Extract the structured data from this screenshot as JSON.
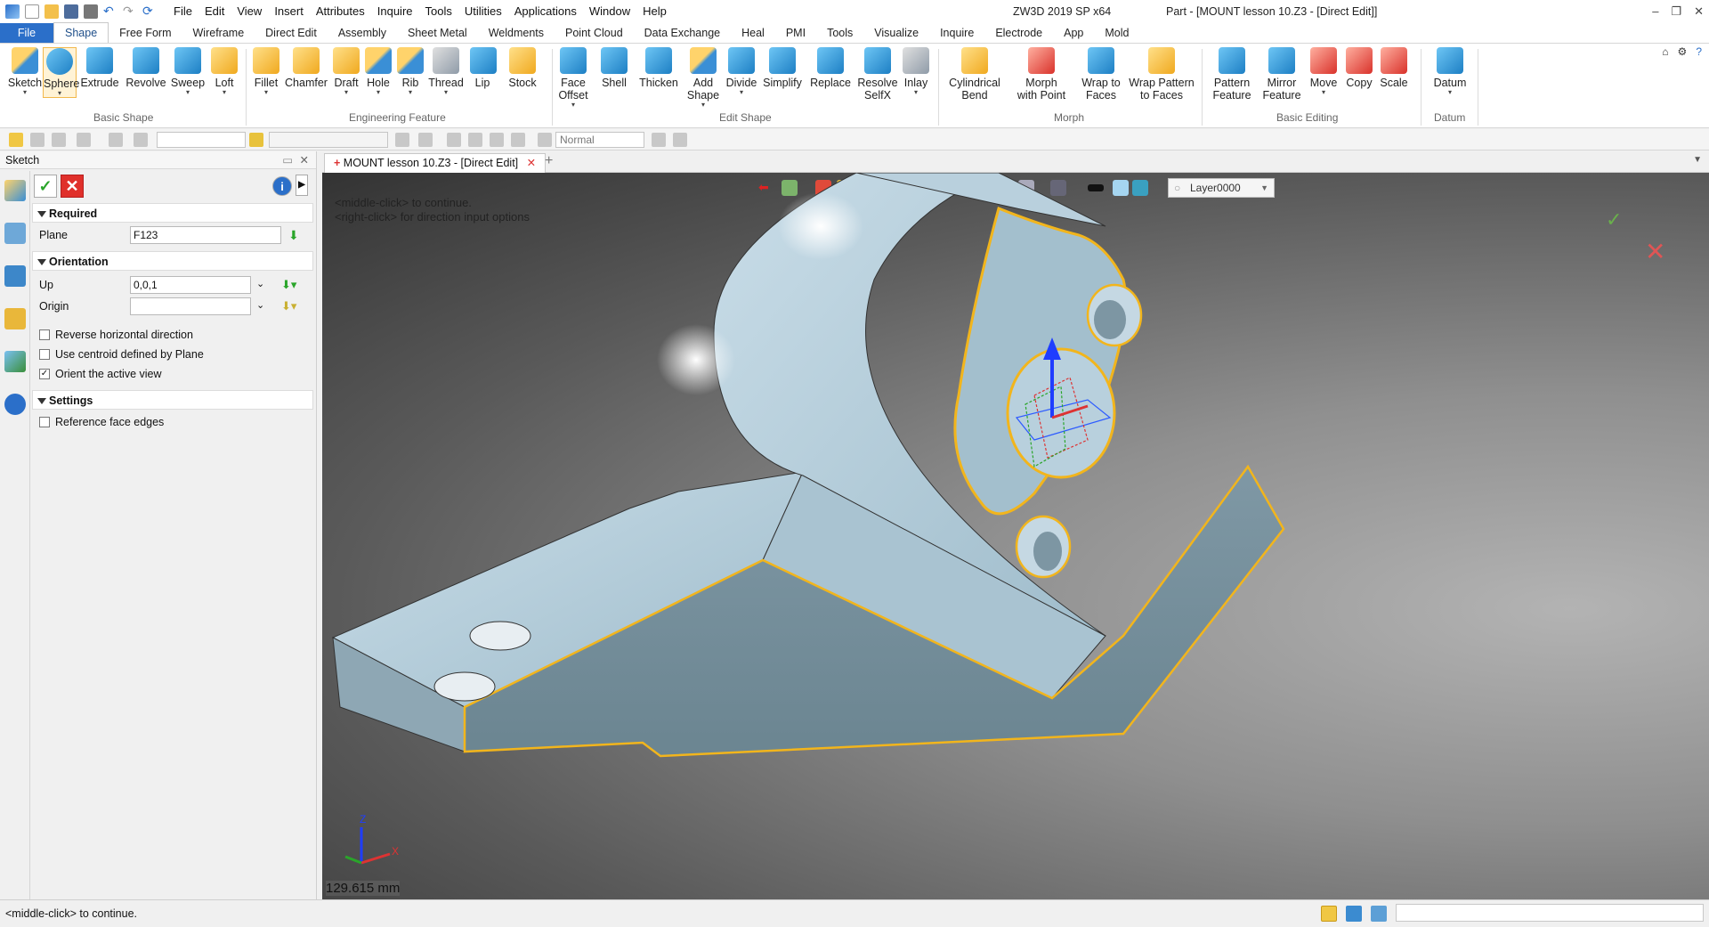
{
  "app": {
    "title": "ZW3D 2019 SP x64",
    "document_title": "Part - [MOUNT lesson 10.Z3 - [Direct Edit]]",
    "menu": [
      "File",
      "Edit",
      "View",
      "Insert",
      "Attributes",
      "Inquire",
      "Tools",
      "Utilities",
      "Applications",
      "Window",
      "Help"
    ]
  },
  "ribbon_tabs": [
    "File",
    "Shape",
    "Free Form",
    "Wireframe",
    "Direct Edit",
    "Assembly",
    "Sheet Metal",
    "Weldments",
    "Point Cloud",
    "Data Exchange",
    "Heal",
    "PMI",
    "Tools",
    "Visualize",
    "Inquire",
    "Electrode",
    "App",
    "Mold"
  ],
  "ribbon_groups": {
    "basic_shape": {
      "label": "Basic Shape",
      "buttons": [
        "Sketch",
        "Sphere",
        "Extrude",
        "Revolve",
        "Sweep",
        "Loft"
      ]
    },
    "engineering_feature": {
      "label": "Engineering Feature",
      "buttons": [
        "Fillet",
        "Chamfer",
        "Draft",
        "Hole",
        "Rib",
        "Thread",
        "Lip",
        "Stock"
      ]
    },
    "edit_shape": {
      "label": "Edit Shape",
      "buttons": [
        "Face Offset",
        "Shell",
        "Thicken",
        "Add Shape",
        "Divide",
        "Simplify",
        "Replace",
        "Resolve SelfX",
        "Inlay"
      ]
    },
    "morph": {
      "label": "Morph",
      "buttons": [
        "Cylindrical Bend",
        "Morph with Point",
        "Wrap to Faces",
        "Wrap Pattern to Faces"
      ]
    },
    "basic_editing": {
      "label": "Basic Editing",
      "buttons": [
        "Pattern Feature",
        "Mirror Feature",
        "Move",
        "Copy",
        "Scale"
      ]
    },
    "datum": {
      "label": "Datum",
      "buttons": [
        "Datum"
      ]
    }
  },
  "toolbar": {
    "style_combo": "Normal"
  },
  "panel": {
    "title": "Sketch",
    "required": {
      "label": "Required",
      "plane_label": "Plane",
      "plane_value": "F123"
    },
    "orientation": {
      "label": "Orientation",
      "up_label": "Up",
      "up_value": "0,0,1",
      "origin_label": "Origin",
      "origin_value": "",
      "checks": [
        {
          "label": "Reverse horizontal direction",
          "checked": false
        },
        {
          "label": "Use centroid defined by Plane",
          "checked": false
        },
        {
          "label": "Orient the active view",
          "checked": true
        }
      ]
    },
    "settings": {
      "label": "Settings",
      "checks": [
        {
          "label": "Reference face edges",
          "checked": false
        }
      ]
    }
  },
  "document_tab": "MOUNT lesson 10.Z3 - [Direct Edit]",
  "viewport": {
    "hint_line1": "<middle-click> to continue.",
    "hint_line2": "<right-click> for direction input options",
    "layer": "Layer0000",
    "measurement": "129.615 mm",
    "axis_z": "Z",
    "axis_x": "X"
  },
  "status": {
    "text": "<middle-click> to continue."
  },
  "colors": {
    "accent": "#2b6fc9",
    "part": "#a8c8d9",
    "highlight": "#f2b51c"
  }
}
